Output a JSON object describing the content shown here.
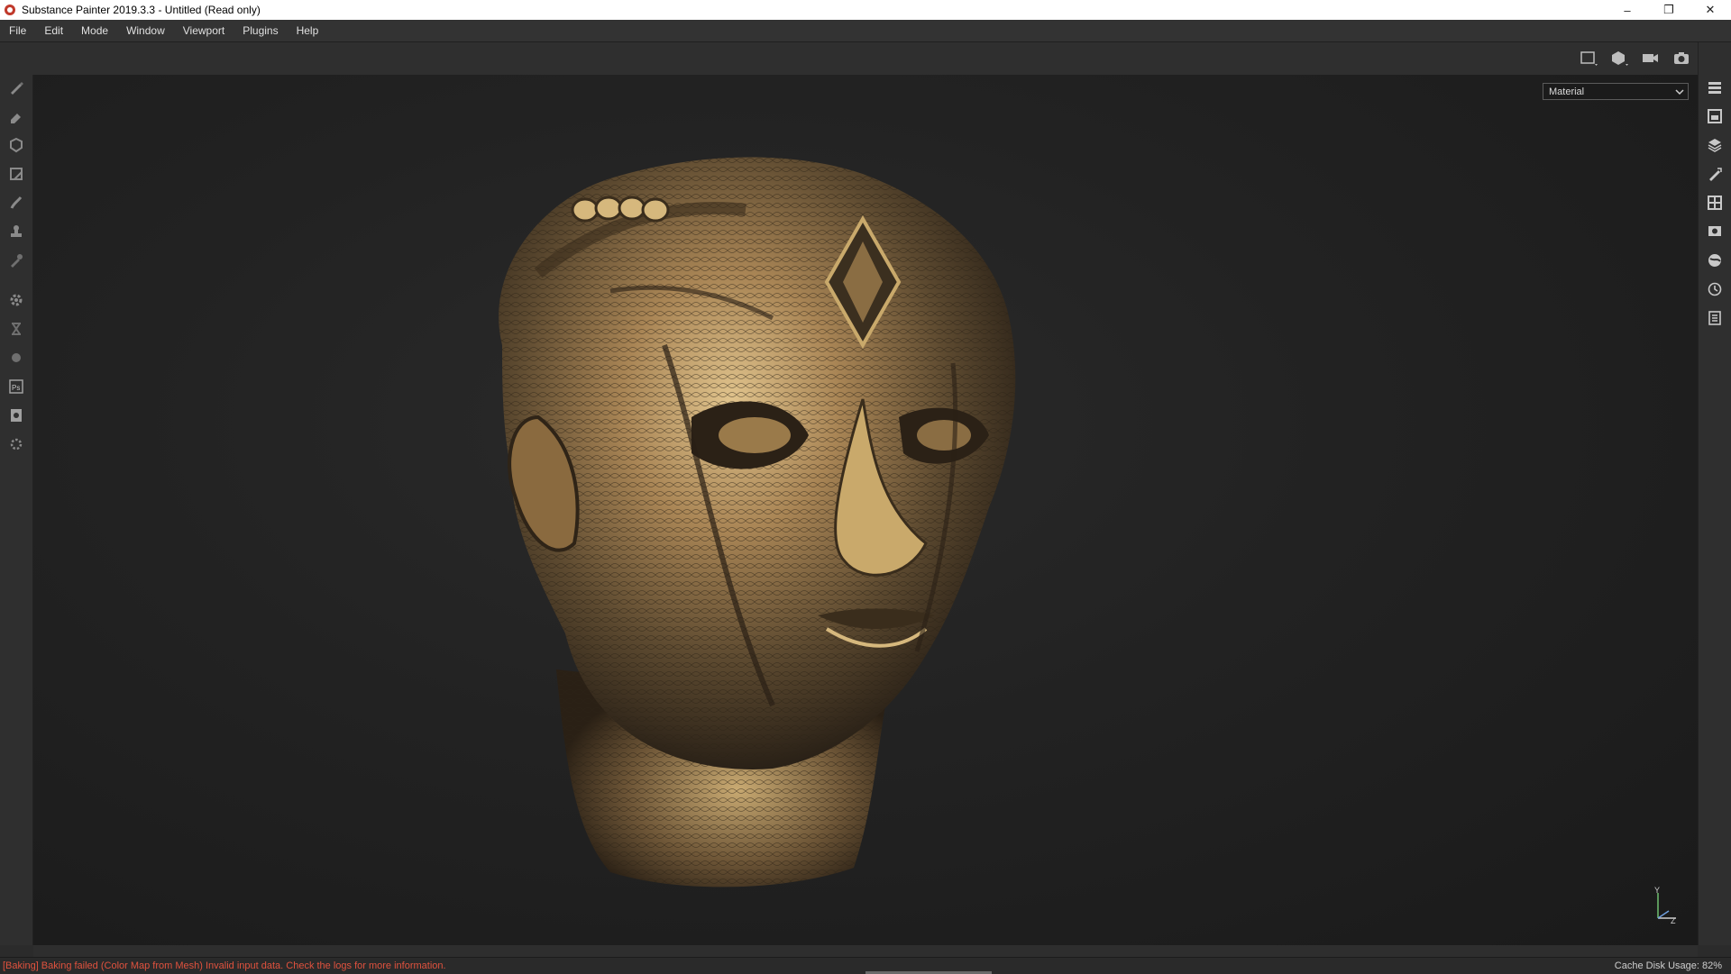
{
  "window": {
    "title": "Substance Painter 2019.3.3 - Untitled (Read only)",
    "controls": {
      "minimize": "–",
      "restore": "❐",
      "close": "✕"
    }
  },
  "menu": {
    "items": [
      "File",
      "Edit",
      "Mode",
      "Window",
      "Viewport",
      "Plugins",
      "Help"
    ]
  },
  "top_toolbar": {
    "icons": [
      "render-mode-icon",
      "perspective-cube-icon",
      "camera-icon",
      "screenshot-icon"
    ]
  },
  "left_tools": [
    "paint-brush-icon",
    "eraser-icon",
    "projection-icon",
    "polygon-fill-icon",
    "smudge-icon",
    "clone-stamp-icon",
    "color-picker-icon",
    "settings-icon",
    "bake-icon",
    "material-icon",
    "photoshop-icon",
    "export-icon",
    "plugins-icon"
  ],
  "right_panels": [
    "layers-stack-icon",
    "texture-set-list-icon",
    "layers-icon",
    "properties-icon",
    "uv-grid-icon",
    "display-settings-icon",
    "shader-settings-icon",
    "history-icon",
    "log-icon"
  ],
  "viewport": {
    "channel_select": {
      "value": "Material"
    },
    "gizmo": {
      "y": "Y",
      "z": "Z"
    },
    "accent_colors": {
      "gold": "#b8935a",
      "dark": "#1e1e1e",
      "error": "#e0523e"
    }
  },
  "status": {
    "error": "[Baking] Baking failed (Color Map from Mesh) Invalid input data. Check the logs for more information.",
    "cache": "Cache Disk Usage:  82%"
  }
}
